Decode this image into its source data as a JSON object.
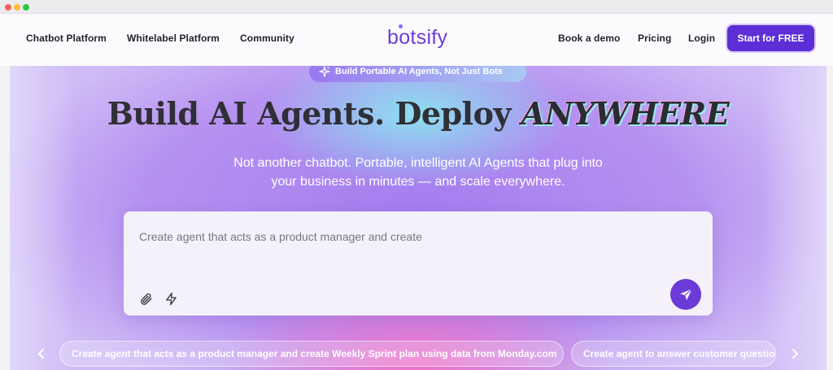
{
  "nav": {
    "links": [
      "Chatbot Platform",
      "Whitelabel Platform",
      "Community"
    ],
    "logo": "botsify",
    "right_links": [
      "Book a demo",
      "Pricing",
      "Login"
    ],
    "cta": "Start for FREE"
  },
  "hero": {
    "badge": "Build Portable AI Agents, Not Just Bots",
    "headline_main": "Build AI Agents. Deploy ",
    "headline_emphasis": "ANYWHERE",
    "subtitle_line1": "Not another chatbot. Portable, intelligent AI Agents that plug into",
    "subtitle_line2": "your business in minutes — and scale everywhere.",
    "prompt_text": "Create agent that acts as a product manager and create",
    "suggestions": [
      "Create agent that acts as a product manager and create Weekly Sprint plan using data from Monday.com",
      "Create agent to answer customer questions"
    ]
  },
  "colors": {
    "brand": "#5b2ed6",
    "send": "#6c3ad6",
    "logo": "#6c3fd6"
  },
  "icons": [
    "sparkle-icon",
    "paperclip-icon",
    "bolt-icon",
    "send-icon",
    "chevron-left-icon",
    "chevron-right-icon"
  ]
}
